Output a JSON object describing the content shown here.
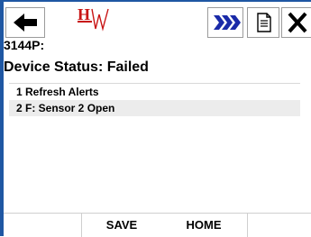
{
  "header": {
    "icons": {
      "back": "left-arrow-icon",
      "logo": "hw-logo",
      "forward": "double-chevron-right-icon",
      "doc": "document-icon",
      "close": "close-icon"
    },
    "colors": {
      "frame": "#1f57a3",
      "logo_red": "#c81414",
      "forward_blue": "#1a2aa8"
    }
  },
  "device": {
    "id": "3144P:",
    "status_label": "Device Status: Failed"
  },
  "list": {
    "items": [
      {
        "label": "1 Refresh Alerts"
      },
      {
        "label": "2 F: Sensor 2 Open"
      }
    ]
  },
  "footer": {
    "save_label": "SAVE",
    "home_label": "HOME"
  }
}
